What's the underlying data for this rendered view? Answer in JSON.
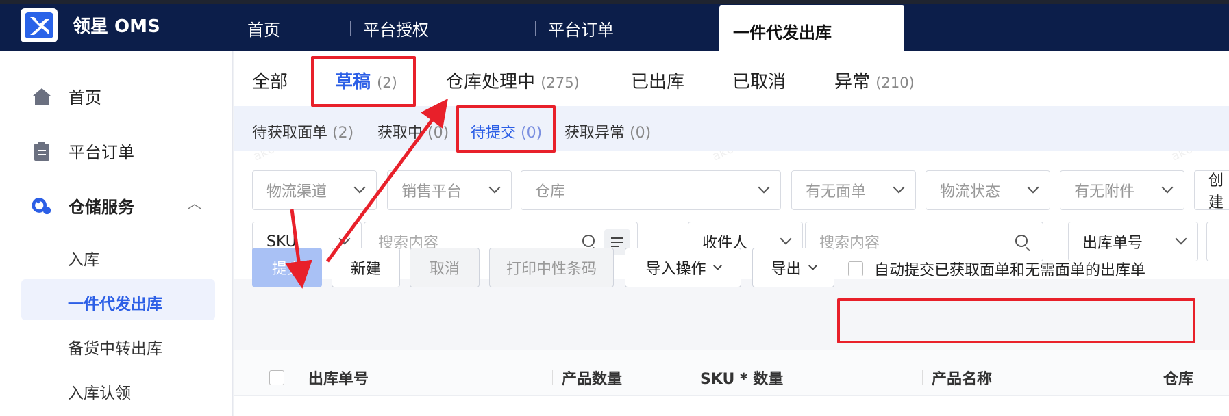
{
  "header": {
    "app_title": "领星 OMS",
    "nav": [
      "首页",
      "平台授权",
      "平台订单"
    ],
    "active_nav": "一件代发出库"
  },
  "sidebar": {
    "items": [
      {
        "label": "首页",
        "icon": "home-icon"
      },
      {
        "label": "平台订单",
        "icon": "clipboard-icon"
      },
      {
        "label": "仓储服务",
        "icon": "warehouse-service-icon"
      }
    ],
    "sub_items": [
      "入库",
      "一件代发出库",
      "备货中转出库",
      "入库认领"
    ]
  },
  "status_tabs": [
    {
      "label": "全部",
      "count": ""
    },
    {
      "label": "草稿",
      "count": "(2)"
    },
    {
      "label": "仓库处理中",
      "count": "(275)"
    },
    {
      "label": "已出库",
      "count": ""
    },
    {
      "label": "已取消",
      "count": ""
    },
    {
      "label": "异常",
      "count": "(210)"
    }
  ],
  "sub_tabs": [
    {
      "label": "待获取面单",
      "count": "(2)"
    },
    {
      "label": "获取中",
      "count": "(0)"
    },
    {
      "label": "待提交",
      "count": "(0)"
    },
    {
      "label": "获取异常",
      "count": "(0)"
    }
  ],
  "filters": {
    "row1": [
      "物流渠道",
      "销售平台",
      "仓库",
      "有无面单",
      "物流状态",
      "有无附件",
      "创建"
    ],
    "sku_select": "SKU",
    "search_placeholder_1": "搜索内容",
    "recipient_select": "收件人",
    "search_placeholder_2": "搜索内容",
    "order_no_select": "出库单号"
  },
  "actions": {
    "submit": "提交",
    "create": "新建",
    "cancel": "取消",
    "print_barcode": "打印中性条码",
    "import": "导入操作",
    "export": "导出",
    "auto_submit": "自动提交已获取面单和无需面单的出库单"
  },
  "table": {
    "columns": [
      "出库单号",
      "产品数量",
      "SKU * 数量",
      "产品名称",
      "仓库"
    ]
  },
  "watermark": {
    "line1": "1005001",
    "line2": "ak00-1中文"
  },
  "colors": {
    "brand_navy": "#0c1e4a",
    "accent_blue": "#2c5fe6",
    "annotation_red": "#e8202a"
  }
}
